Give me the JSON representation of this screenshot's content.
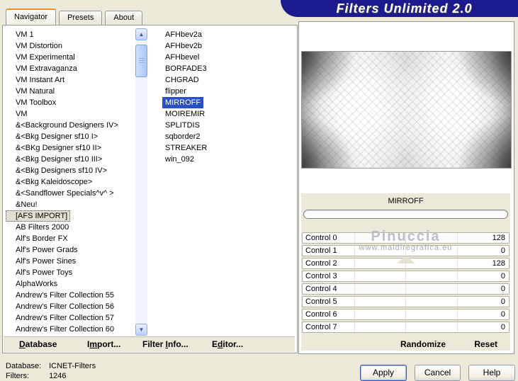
{
  "window": {
    "title": "Filters Unlimited 2.0"
  },
  "tabs": [
    {
      "label": "Navigator"
    },
    {
      "label": "Presets"
    },
    {
      "label": "About"
    }
  ],
  "left_list": {
    "selected": "[AFS IMPORT]",
    "items": [
      "VM 1",
      "VM Distortion",
      "VM Experimental",
      "VM Extravaganza",
      "VM Instant Art",
      "VM Natural",
      "VM Toolbox",
      "VM",
      "&<Background Designers IV>",
      "&<Bkg Designer sf10 I>",
      "&<BKg Designer sf10 II>",
      "&<Bkg Designer sf10 III>",
      "&<Bkg Designers sf10 IV>",
      "&<Bkg Kaleidoscope>",
      "&<Sandflower Specials^v^ >",
      "&Neu!",
      "[AFS IMPORT]",
      "AB Filters 2000",
      "Alf's Border FX",
      "Alf's Power Grads",
      "Alf's Power Sines",
      "Alf's Power Toys",
      "AlphaWorks",
      "Andrew's Filter Collection 55",
      "Andrew's Filter Collection 56",
      "Andrew's Filter Collection 57",
      "Andrew's Filter Collection 60"
    ]
  },
  "filter_list": {
    "selected": "MIRROFF",
    "items": [
      "AFHbev2a",
      "AFHbev2b",
      "AFHbevel",
      "BORFADE3",
      "CHGRAD",
      "flipper",
      "MIRROFF",
      "MOIREMIR",
      "SPLITDIS",
      "sqborder2",
      "STREAKER",
      "win_092"
    ]
  },
  "preview": {
    "filter_name": "MIRROFF"
  },
  "controls": [
    {
      "label": "Control 0",
      "value": "128"
    },
    {
      "label": "Control 1",
      "value": "0"
    },
    {
      "label": "Control 2",
      "value": "128"
    },
    {
      "label": "Control 3",
      "value": "0"
    },
    {
      "label": "Control 4",
      "value": "0"
    },
    {
      "label": "Control 5",
      "value": "0"
    },
    {
      "label": "Control 6",
      "value": "0"
    },
    {
      "label": "Control 7",
      "value": "0"
    }
  ],
  "control_actions": {
    "randomize": "Randomize",
    "reset": "Reset"
  },
  "watermark": {
    "line1": "Pinuccia",
    "line2": "www.maidiregrafica.eu"
  },
  "menu": [
    {
      "pre": "",
      "key": "D",
      "post": "atabase"
    },
    {
      "pre": "I",
      "key": "m",
      "post": "port..."
    },
    {
      "pre": "Filter ",
      "key": "I",
      "post": "nfo..."
    },
    {
      "pre": "E",
      "key": "d",
      "post": "itor...",
      "note": ""
    }
  ],
  "status": [
    {
      "label": "Database:",
      "value": "ICNET-Filters"
    },
    {
      "label": "Filters:",
      "value": "1246"
    }
  ],
  "buttons": {
    "apply": "Apply",
    "cancel": "Cancel",
    "help": "Help"
  },
  "icons": {
    "scroll_up": "▲",
    "scroll_down": "▼"
  },
  "colors": {
    "banner": "#1b1b8e",
    "selection": "#2a50c8",
    "dialog_bg": "#ece9d8",
    "tab_accent": "#e5912d"
  }
}
